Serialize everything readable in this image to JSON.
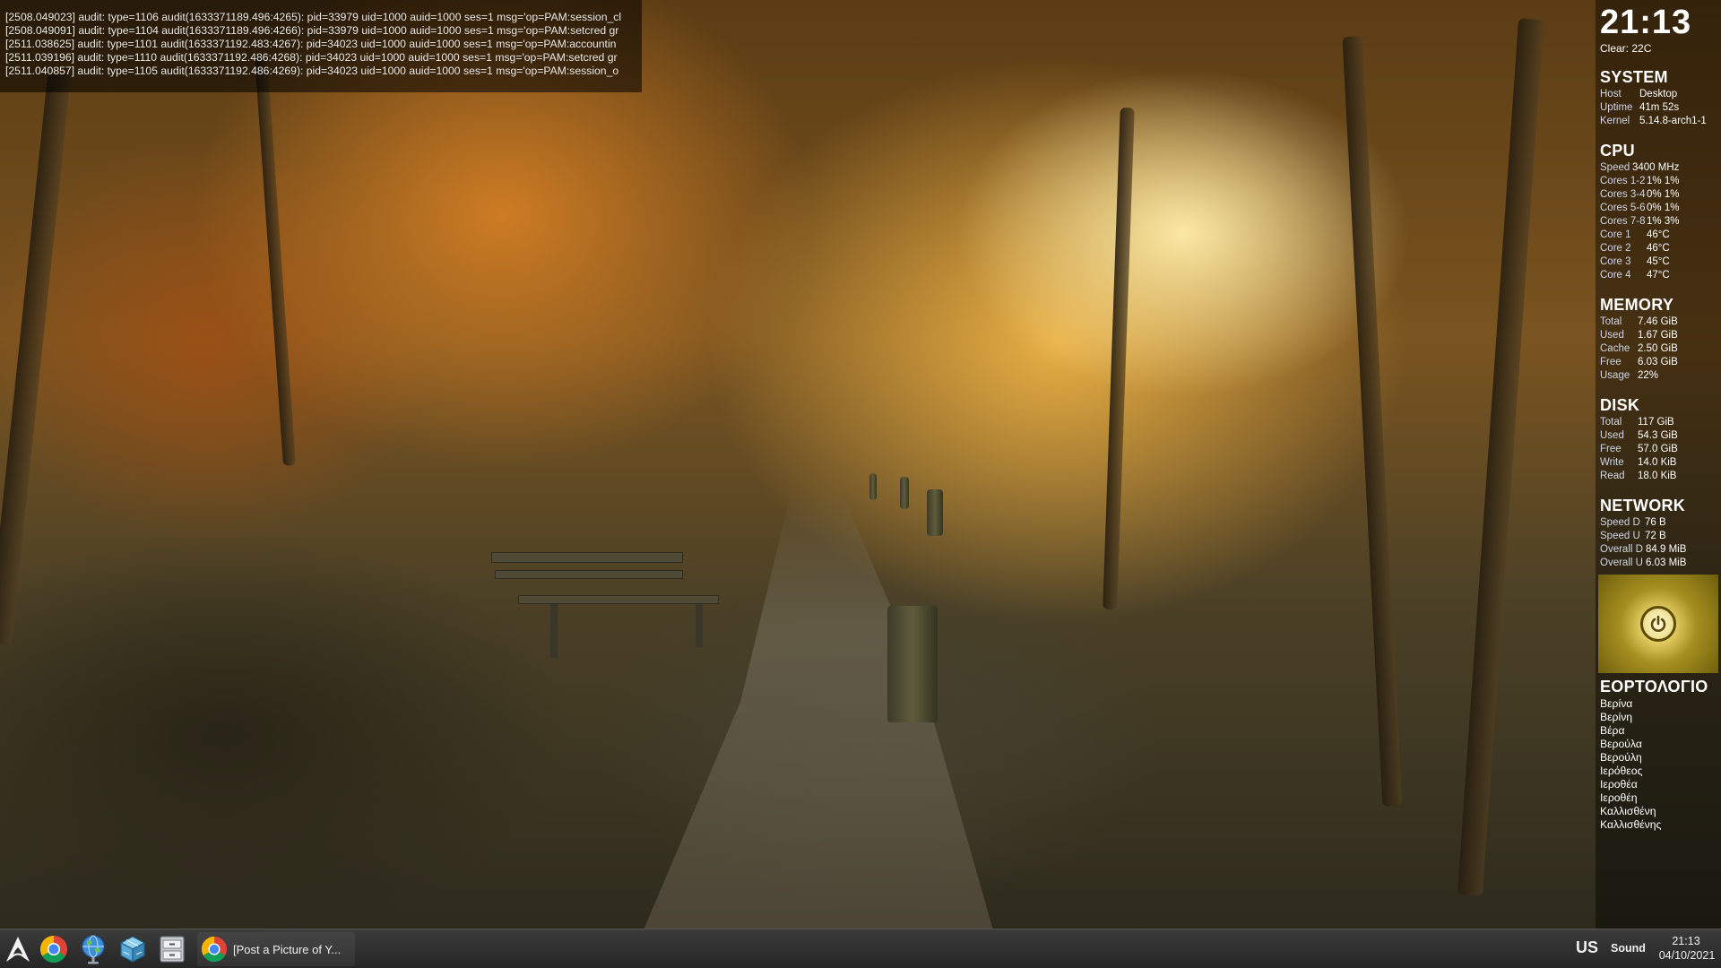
{
  "log": {
    "lines": [
      "[2508.049023] audit: type=1106 audit(1633371189.496:4265): pid=33979 uid=1000 auid=1000 ses=1 msg='op=PAM:session_cl",
      "[2508.049091] audit: type=1104 audit(1633371189.496:4266): pid=33979 uid=1000 auid=1000 ses=1 msg='op=PAM:setcred gr",
      "[2511.038625] audit: type=1101 audit(1633371192.483:4267): pid=34023 uid=1000 auid=1000 ses=1 msg='op=PAM:accountin",
      "[2511.039196] audit: type=1110 audit(1633371192.486:4268): pid=34023 uid=1000 auid=1000 ses=1 msg='op=PAM:setcred gr",
      "[2511.040857] audit: type=1105 audit(1633371192.486:4269): pid=34023 uid=1000 auid=1000 ses=1 msg='op=PAM:session_o"
    ]
  },
  "conky": {
    "clock": "21:13",
    "weather": "Clear: 22C",
    "system": {
      "title": "SYSTEM",
      "rows": [
        {
          "label": "Host",
          "value": "Desktop"
        },
        {
          "label": "Uptime",
          "value": "41m 52s"
        },
        {
          "label": "Kernel",
          "value": "5.14.8-arch1-1"
        }
      ]
    },
    "cpu": {
      "title": "CPU",
      "speed": {
        "label": "Speed",
        "value": "3400 MHz"
      },
      "cores": [
        {
          "label": "Cores 1-2",
          "value": "1% 1%"
        },
        {
          "label": "Cores 3-4",
          "value": "0% 1%"
        },
        {
          "label": "Cores 5-6",
          "value": "0% 1%"
        },
        {
          "label": "Cores 7-8",
          "value": "1% 3%"
        }
      ],
      "temps": [
        {
          "label": "Core 1",
          "value": "46°C"
        },
        {
          "label": "Core 2",
          "value": "46°C"
        },
        {
          "label": "Core 3",
          "value": "45°C"
        },
        {
          "label": "Core 4",
          "value": "47°C"
        }
      ]
    },
    "memory": {
      "title": "MEMORY",
      "rows": [
        {
          "label": "Total",
          "value": "7.46 GiB"
        },
        {
          "label": "Used",
          "value": "1.67 GiB"
        },
        {
          "label": "Cache",
          "value": "2.50 GiB"
        },
        {
          "label": "Free",
          "value": "6.03 GiB"
        },
        {
          "label": "Usage",
          "value": "22%"
        }
      ]
    },
    "disk": {
      "title": "DISK",
      "rows": [
        {
          "label": "Total",
          "value": "117 GiB"
        },
        {
          "label": "Used",
          "value": "54.3 GiB"
        },
        {
          "label": "Free",
          "value": "57.0 GiB"
        },
        {
          "label": "Write",
          "value": "14.0 KiB"
        },
        {
          "label": "Read",
          "value": "18.0 KiB"
        }
      ]
    },
    "network": {
      "title": "NETWORK",
      "rows": [
        {
          "label": "Speed D",
          "value": "76 B"
        },
        {
          "label": "Speed U",
          "value": "72 B"
        },
        {
          "label": "Overall D",
          "value": "84.9 MiB"
        },
        {
          "label": "Overall U",
          "value": "6.03 MiB"
        }
      ]
    },
    "nameday": {
      "title": "ΕΟΡΤΟΛΟΓΙΟ",
      "names": [
        "Βερίνα",
        "Βερίνη",
        "Βέρα",
        "Βερούλα",
        "Βερούλη",
        "Ιερόθεος",
        "Ιεροθέα",
        "Ιεροθέη",
        "Καλλισθένη",
        "Καλλισθένης"
      ]
    }
  },
  "taskbar": {
    "window_title": "[Post a Picture of Y...",
    "keyboard_layout": "US",
    "sound_label": "Sound",
    "time": "21:13",
    "date": "04/10/2021"
  },
  "colors": {
    "chrome_red": "#db4437",
    "chrome_yellow": "#f4b400",
    "chrome_green": "#0f9d58",
    "chrome_blue": "#4285f4",
    "arch_white": "#f2f2f2"
  },
  "icons": {
    "launcher": "arch-logo-icon",
    "browser": "chrome-icon",
    "network": "globe-icon",
    "virtualbox": "virtualbox-cube-icon",
    "files": "file-cabinet-icon",
    "power": "power-icon"
  }
}
